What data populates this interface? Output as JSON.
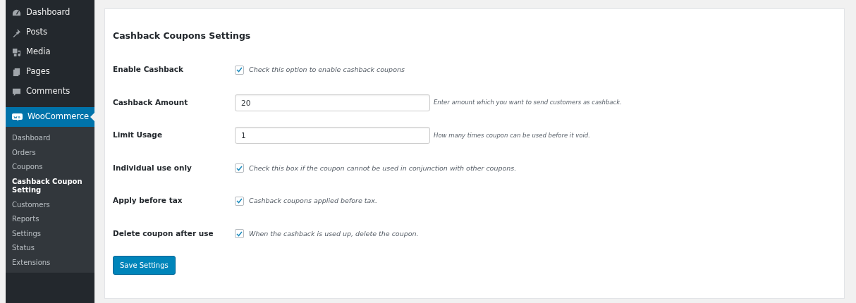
{
  "sidebar": {
    "items": [
      {
        "label": "Dashboard",
        "selected": false
      },
      {
        "label": "Posts",
        "selected": false
      },
      {
        "label": "Media",
        "selected": false
      },
      {
        "label": "Pages",
        "selected": false
      },
      {
        "label": "Comments",
        "selected": false
      },
      {
        "label": "WooCommerce",
        "selected": true,
        "children": [
          {
            "label": "Dashboard",
            "selected": false
          },
          {
            "label": "Orders",
            "selected": false
          },
          {
            "label": "Coupons",
            "selected": false
          },
          {
            "label": "Cashback Coupon Setting",
            "selected": true
          },
          {
            "label": "Customers",
            "selected": false
          },
          {
            "label": "Reports",
            "selected": false
          },
          {
            "label": "Settings",
            "selected": false
          },
          {
            "label": "Status",
            "selected": false
          },
          {
            "label": "Extensions",
            "selected": false
          }
        ]
      }
    ]
  },
  "settings": {
    "title": "Cashback Coupons Settings",
    "fields": [
      {
        "kind": "checkbox",
        "label": "Enable Cashback",
        "checked": true,
        "description": "Check this option to enable cashback coupons"
      },
      {
        "kind": "text",
        "label": "Cashback Amount",
        "value": "20",
        "description": "Enter amount which you want to send customers as cashback."
      },
      {
        "kind": "text",
        "label": "Limit Usage",
        "value": "1",
        "description": "How many times coupon can be used before it void."
      },
      {
        "kind": "checkbox",
        "label": "Individual use only",
        "checked": true,
        "description": "Check this box if the coupon cannot be used in conjunction with other coupons."
      },
      {
        "kind": "checkbox",
        "label": "Apply before tax",
        "checked": true,
        "description": "Cashback coupons applied before tax."
      },
      {
        "kind": "checkbox",
        "label": "Delete coupon after use",
        "checked": true,
        "description": "When the cashback is used up, delete the coupon."
      }
    ],
    "save_button": "Save Settings"
  }
}
